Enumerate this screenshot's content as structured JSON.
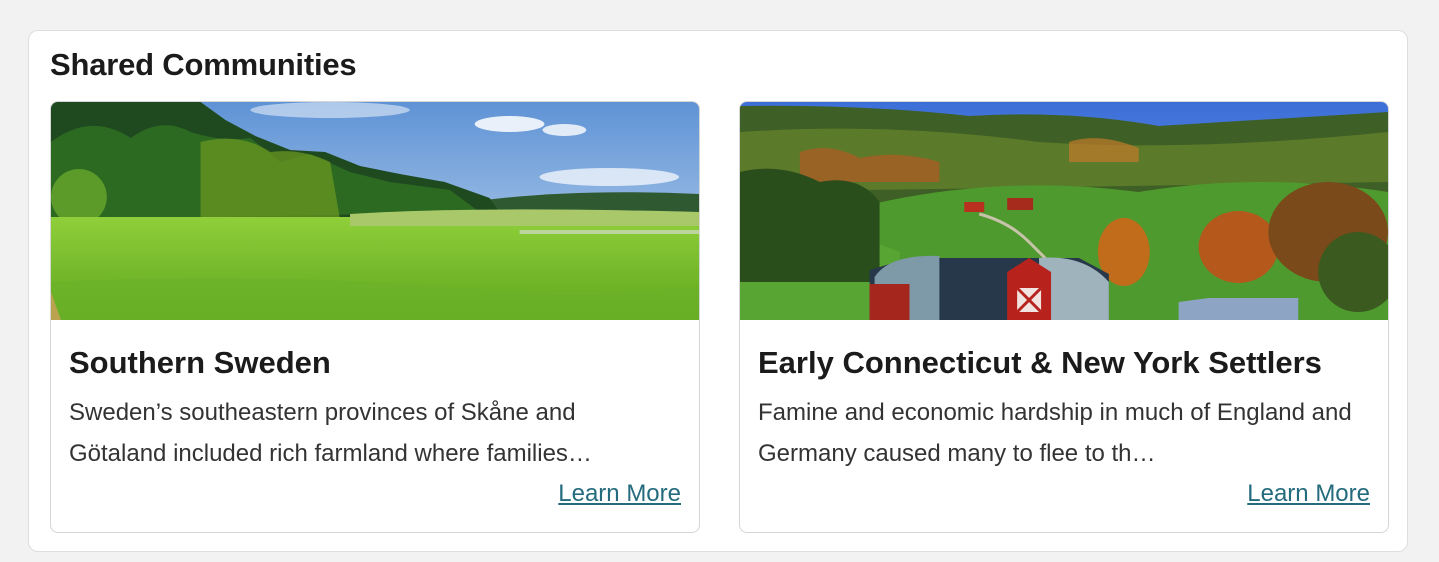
{
  "section": {
    "title": "Shared Communities"
  },
  "cards": [
    {
      "image_label": "green-meadow-forest-photo",
      "title": "Southern Sweden",
      "description": "Sweden’s southeastern provinces of Skåne and Götaland included rich farmland where families…",
      "link_label": "Learn More"
    },
    {
      "image_label": "farm-hillside-red-barn-photo",
      "title": "Early Connecticut & New York Settlers",
      "description": "Famine and economic hardship in much of England and Germany caused many to flee to th…",
      "link_label": "Learn More"
    }
  ],
  "colors": {
    "link": "#246b7d",
    "title_text": "#1b1b1b",
    "body_text": "#333333",
    "page_background": "#f2f2f2",
    "panel_border": "#dedede"
  }
}
